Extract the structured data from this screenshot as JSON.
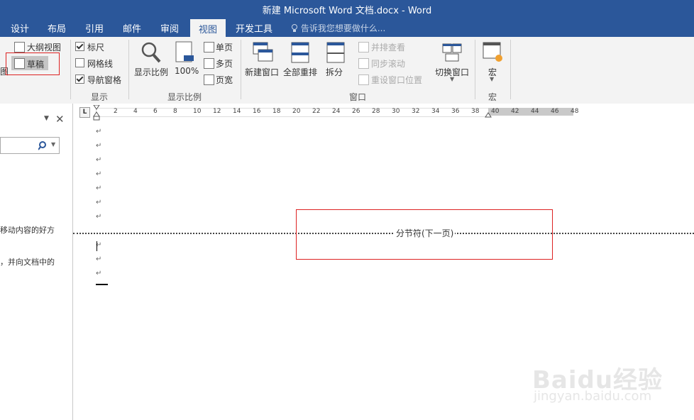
{
  "window": {
    "title": "新建 Microsoft Word 文档.docx - Word"
  },
  "tabs": [
    "设计",
    "布局",
    "引用",
    "邮件",
    "审阅",
    "视图",
    "开发工具"
  ],
  "active_tab": "视图",
  "tell_me": "告诉我您想要做什么...",
  "ribbon": {
    "views": {
      "outline": "大纲视图",
      "draft": "草稿",
      "partial_label": "图"
    },
    "show": {
      "ruler": "标尺",
      "gridlines": "网格线",
      "nav_pane": "导航窗格",
      "group": "显示",
      "ruler_checked": true,
      "gridlines_checked": false,
      "nav_checked": true
    },
    "zoom": {
      "zoom": "显示比例",
      "hundred": "100%",
      "one_page": "单页",
      "multi_page": "多页",
      "page_width": "页宽",
      "group": "显示比例"
    },
    "window": {
      "new_window": "新建窗口",
      "arrange_all": "全部重排",
      "split": "拆分",
      "side_by_side": "并排查看",
      "sync_scroll": "同步滚动",
      "reset_position": "重设窗口位置",
      "switch_windows": "切换窗口",
      "group": "窗口"
    },
    "macros": {
      "macros": "宏",
      "group": "宏"
    }
  },
  "nav_pane": {
    "text1": "移动内容的好方",
    "text2": "，并向文档中的"
  },
  "ruler": {
    "corner": "L",
    "ticks": [
      "2",
      "4",
      "6",
      "8",
      "10",
      "12",
      "14",
      "16",
      "18",
      "20",
      "22",
      "24",
      "26",
      "28",
      "30",
      "32",
      "34",
      "36",
      "38",
      "40",
      "42",
      "44",
      "46",
      "48"
    ]
  },
  "document": {
    "section_break": "分节符(下一页)",
    "para_mark": "↵"
  },
  "watermark": {
    "brand": "Baidu经验",
    "url": "jingyan.baidu.com"
  }
}
